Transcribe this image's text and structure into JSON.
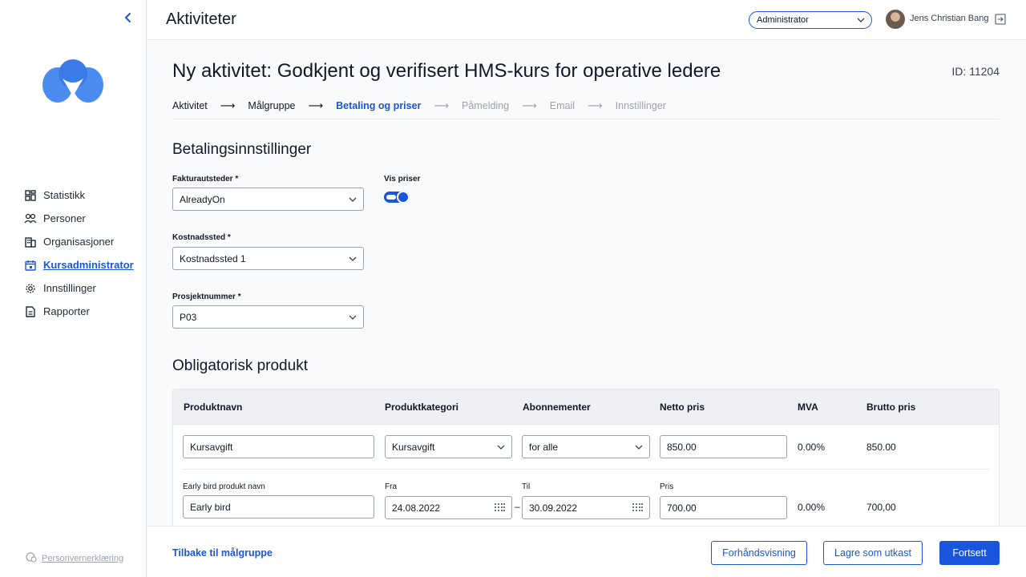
{
  "sidebar": {
    "items": [
      {
        "label": "Statistikk"
      },
      {
        "label": "Personer"
      },
      {
        "label": "Organisasjoner"
      },
      {
        "label": "Kursadministrator"
      },
      {
        "label": "Innstillinger"
      },
      {
        "label": "Rapporter"
      }
    ],
    "privacy_label": "Personvernerklæring"
  },
  "header": {
    "title": "Aktiviteter",
    "role": "Administrator",
    "user_name": "Jens Christian Bang"
  },
  "main": {
    "page_title": "Ny aktivitet: Godkjent og verifisert HMS-kurs for operative ledere",
    "page_id": "ID: 11204",
    "steps": [
      {
        "label": "Aktivitet"
      },
      {
        "label": "Målgruppe"
      },
      {
        "label": "Betaling og priser"
      },
      {
        "label": "Påmelding"
      },
      {
        "label": "Email"
      },
      {
        "label": "Innstillinger"
      }
    ],
    "payment": {
      "section_title": "Betalingsinnstillinger",
      "invoicer_label": "Fakturautsteder *",
      "invoicer_value": "AlreadyOn",
      "show_prices_label": "Vis priser",
      "show_prices_on": true,
      "cost_center_label": "Kostnadssted *",
      "cost_center_value": "Kostnadssted 1",
      "project_label": "Prosjektnummer *",
      "project_value": "P03"
    },
    "product": {
      "section_title": "Obligatorisk produkt",
      "headers": [
        "Produktnavn",
        "Produktkategori",
        "Abonnementer",
        "Netto pris",
        "MVA",
        "Brutto pris"
      ],
      "row": {
        "name": "Kursavgift",
        "category": "Kursavgift",
        "subscription": "for alle",
        "net_price": "850.00",
        "vat": "0.00%",
        "gross_price": "850.00"
      },
      "early_bird": {
        "name_label": "Early bird produkt navn",
        "name_value": "Early bird",
        "from_label": "Fra",
        "from_value": "24.08.2022",
        "to_label": "Til",
        "to_value": "30.09.2022",
        "price_label": "Pris",
        "price_value": "700.00",
        "vat": "0.00%",
        "gross_price": "700,00"
      }
    }
  },
  "footer": {
    "back_label": "Tilbake til målgruppe",
    "preview_label": "Forhåndsvisning",
    "draft_label": "Lagre som utkast",
    "continue_label": "Fortsett"
  },
  "colors": {
    "accent": "#1a56db"
  }
}
